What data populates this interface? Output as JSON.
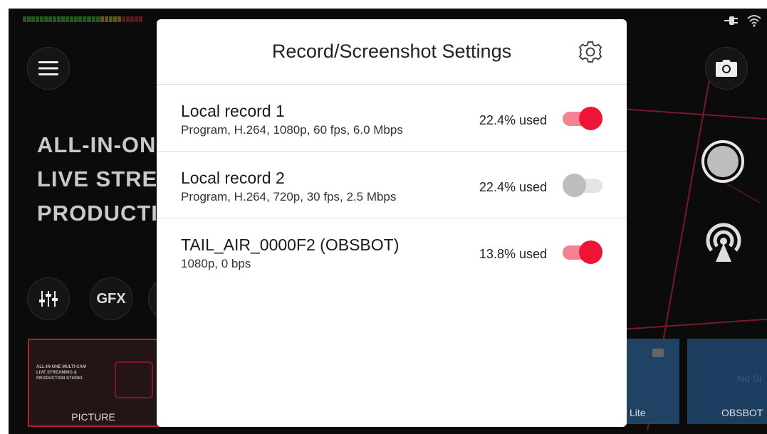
{
  "modal": {
    "title": "Record/Screenshot Settings",
    "settings_icon": "gear-icon",
    "rows": [
      {
        "title": "Local record 1",
        "subtitle": "Program, H.264, 1080p, 60 fps, 6.0 Mbps",
        "usage": "22.4% used",
        "enabled": true
      },
      {
        "title": "Local record 2",
        "subtitle": "Program, H.264, 720p, 30 fps, 2.5 Mbps",
        "usage": "22.4% used",
        "enabled": false
      },
      {
        "title": "TAIL_AIR_0000F2 (OBSBOT)",
        "subtitle": "1080p, 0 bps",
        "usage": "13.8% used",
        "enabled": true
      }
    ]
  },
  "background": {
    "hero_lines": [
      "ALL-IN-ONE",
      "LIVE STREAMING",
      "PRODUCTION"
    ],
    "gfx_label": "GFX",
    "thumbnails": [
      {
        "label": "PICTURE",
        "text_lines": [
          "ALL-IN-ONE MULTI-CAM",
          "LIVE STREAMING &",
          "PRODUCTION STUDIO"
        ]
      },
      {
        "label": "Lite"
      },
      {
        "label": "OBSBOT",
        "signal_text": "No Si"
      }
    ]
  },
  "colors": {
    "accent": "#ee1436",
    "accent_track": "#f38390",
    "off_knob": "#bdbdbd",
    "off_track": "#e4e4e4"
  },
  "icons": [
    "menu-icon",
    "camera-icon",
    "record-icon",
    "broadcast-icon",
    "mixer-icon",
    "gear-icon",
    "power-plug-icon",
    "wifi-icon",
    "battery-icon"
  ]
}
